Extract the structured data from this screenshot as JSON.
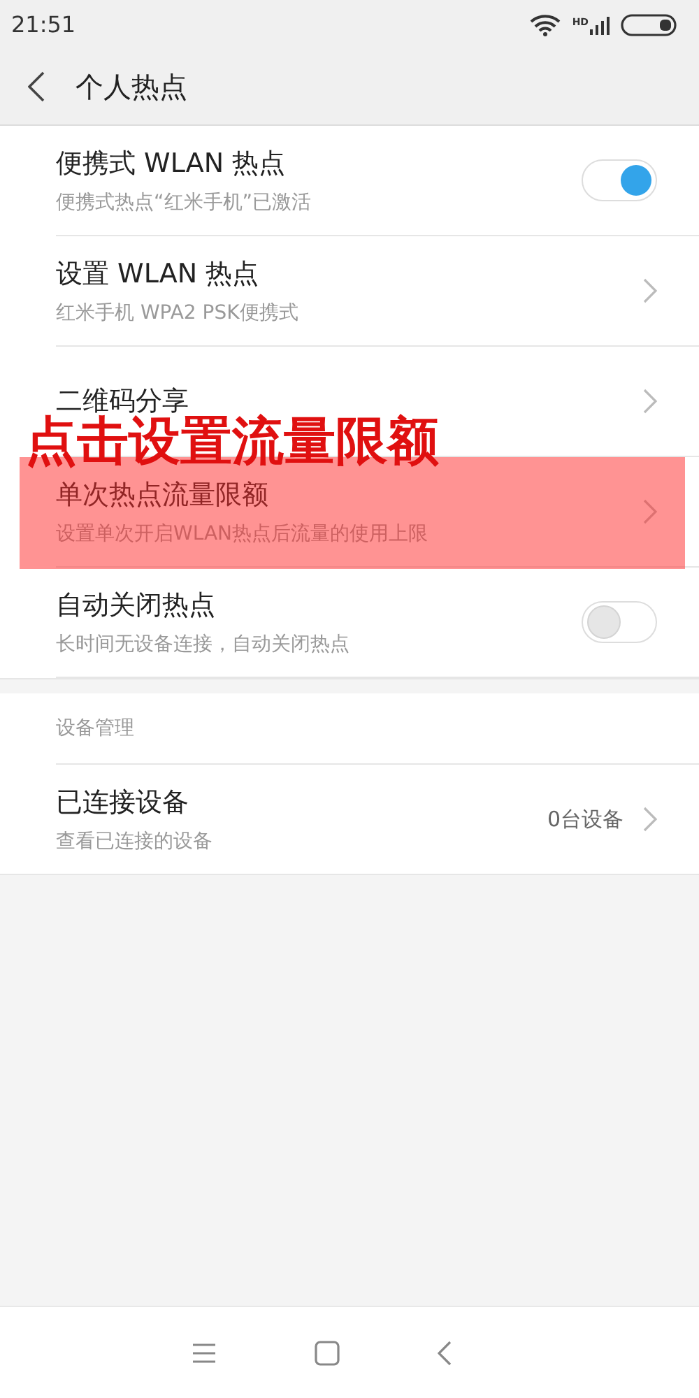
{
  "status_bar": {
    "time": "21:51",
    "network_badge": "HD"
  },
  "header": {
    "title": "个人热点"
  },
  "items": [
    {
      "kind": "toggle",
      "title": "便携式 WLAN 热点",
      "subtitle": "便携式热点“红米手机”已激活",
      "on": true
    },
    {
      "kind": "link",
      "title": "设置 WLAN 热点",
      "subtitle": "红米手机 WPA2 PSK便携式"
    },
    {
      "kind": "link",
      "title": "二维码分享"
    },
    {
      "kind": "link",
      "title": "单次热点流量限额",
      "subtitle": "设置单次开启WLAN热点后流量的使用上限",
      "highlighted": true
    },
    {
      "kind": "toggle",
      "title": "自动关闭热点",
      "subtitle": "长时间无设备连接，自动关闭热点",
      "on": false
    }
  ],
  "annotation": {
    "caption": "点击设置流量限额"
  },
  "device_section": {
    "heading": "设备管理",
    "items": [
      {
        "kind": "link",
        "title": "已连接设备",
        "subtitle": "查看已连接的设备",
        "value": "0台设备"
      }
    ]
  }
}
